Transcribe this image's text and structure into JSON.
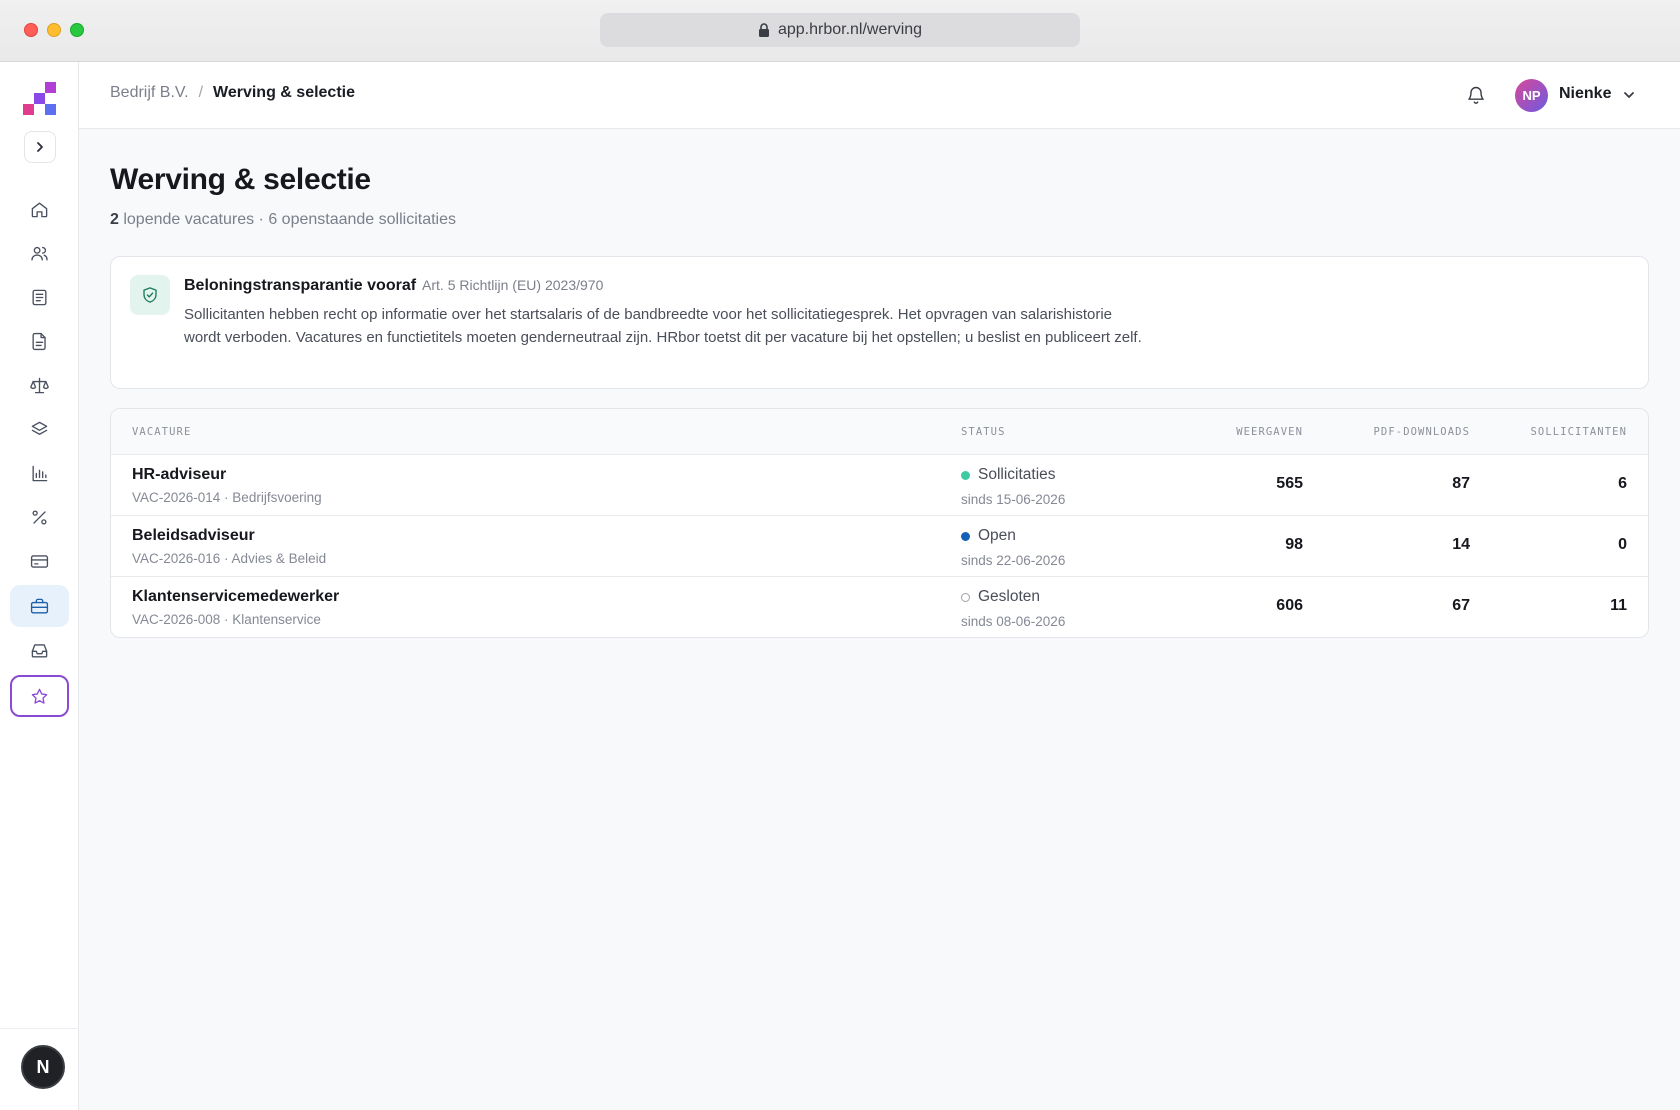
{
  "browser": {
    "url": "app.hrbor.nl/werving"
  },
  "colors": {
    "accent": "#1d5fa8",
    "status_sollicitaties": "#3ec9a0",
    "status_open": "#1460b8",
    "special_border": "#8b4ad6"
  },
  "sidebar": {
    "items": [
      {
        "name": "home-icon"
      },
      {
        "name": "users-icon"
      },
      {
        "name": "list-icon"
      },
      {
        "name": "document-icon"
      },
      {
        "name": "scale-icon"
      },
      {
        "name": "layers-icon"
      },
      {
        "name": "bar-chart-icon"
      },
      {
        "name": "percent-icon"
      },
      {
        "name": "credit-card-icon"
      },
      {
        "name": "briefcase-icon",
        "active": true
      },
      {
        "name": "inbox-icon"
      },
      {
        "name": "star-icon",
        "special": true
      }
    ],
    "bottom_avatar": "N"
  },
  "header": {
    "breadcrumb_parent": "Bedrijf B.V.",
    "breadcrumb_sep": "/",
    "breadcrumb_current": "Werving & selectie",
    "user_initials": "NP",
    "user_name": "Nienke"
  },
  "main": {
    "title": "Werving & selectie",
    "subtitle_count": "2",
    "subtitle_rest": " lopende vacatures · 6 openstaande sollicitaties"
  },
  "notice": {
    "title": "Beloningstransparantie vooraf",
    "reference": "Art. 5 Richtlijn (EU) 2023/970",
    "body": "Sollicitanten hebben recht op informatie over het startsalaris of de bandbreedte voor het sollicitatiegesprek. Het opvragen van salarishistorie wordt verboden. Vacatures en functietitels moeten genderneutraal zijn. HRbor toetst dit per vacature bij het opstellen; u beslist en publiceert zelf."
  },
  "table": {
    "columns": {
      "vacature": "VACATURE",
      "status": "STATUS",
      "weergaven": "WEERGAVEN",
      "pdf": "PDF-DOWNLOADS",
      "sollicitanten": "SOLLICITANTEN"
    },
    "rows": [
      {
        "title": "HR-adviseur",
        "meta": "VAC-2026-014 · Bedrijfsvoering",
        "status": "Sollicitaties",
        "status_color": "#3ec9a0",
        "since": "sinds 15-06-2026",
        "views": "565",
        "pdf": "87",
        "applicants": "6"
      },
      {
        "title": "Beleidsadviseur",
        "meta": "VAC-2026-016 · Advies & Beleid",
        "status": "Open",
        "status_color": "#1460b8",
        "since": "sinds 22-06-2026",
        "views": "98",
        "pdf": "14",
        "applicants": "0"
      },
      {
        "title": "Klantenservicemedewerker",
        "meta": "VAC-2026-008 · Klantenservice",
        "status": "Gesloten",
        "status_color": "hollow",
        "since": "sinds 08-06-2026",
        "views": "606",
        "pdf": "67",
        "applicants": "11"
      }
    ]
  }
}
